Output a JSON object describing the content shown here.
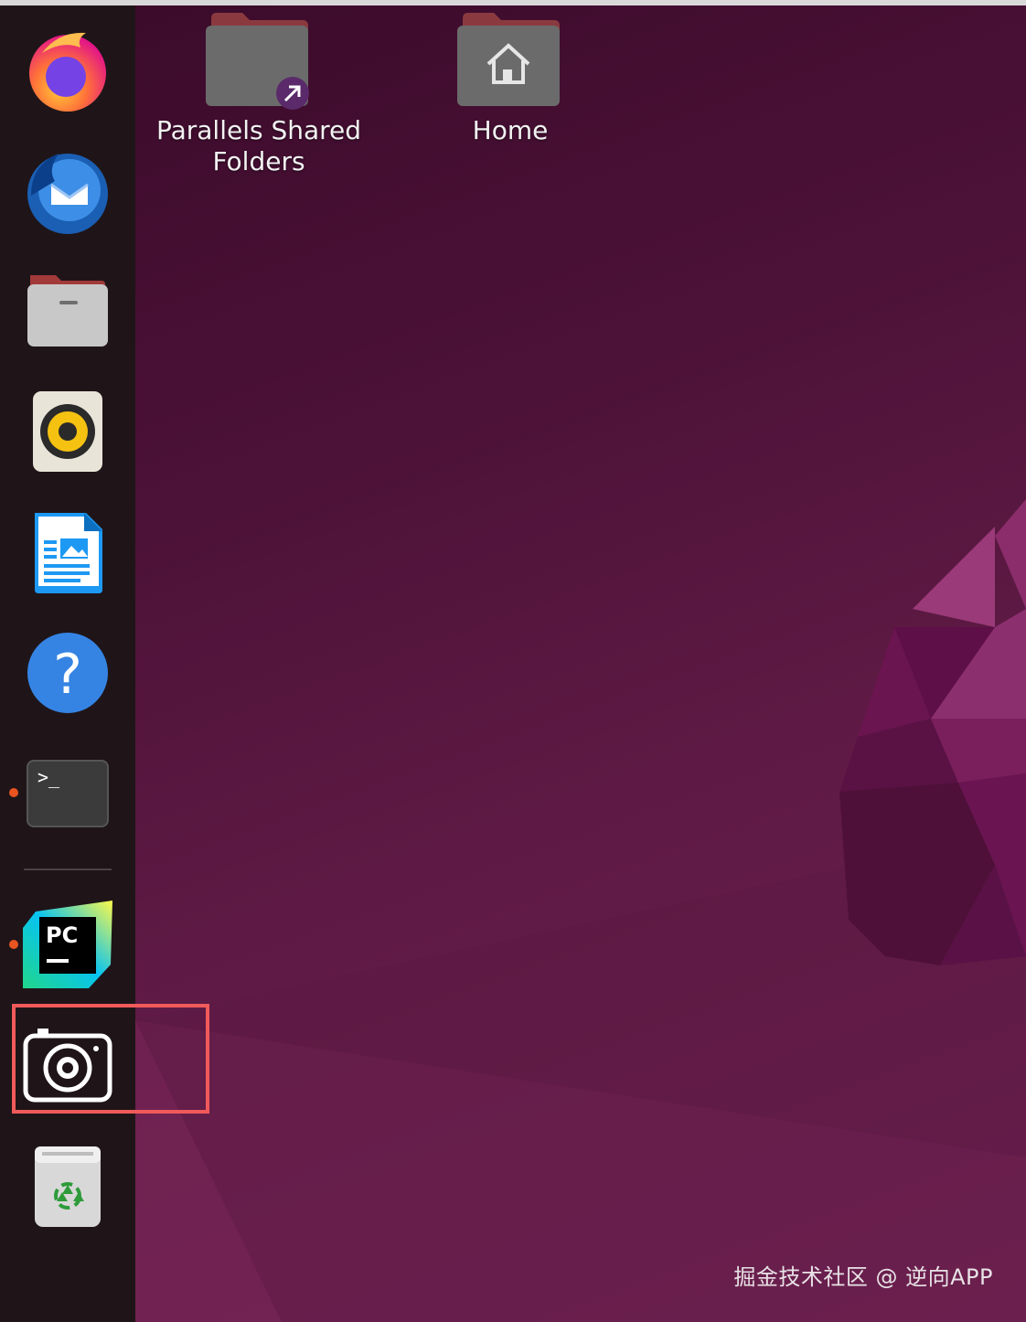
{
  "desktop": {
    "icons": [
      {
        "label": "Parallels Shared Folders",
        "icon": "shared-folder-icon"
      },
      {
        "label": "Home",
        "icon": "home-folder-icon"
      }
    ]
  },
  "dock": {
    "items": [
      {
        "icon": "firefox-icon",
        "running": false
      },
      {
        "icon": "thunderbird-icon",
        "running": false
      },
      {
        "icon": "files-icon",
        "running": false
      },
      {
        "icon": "rhythmbox-icon",
        "running": false
      },
      {
        "icon": "libreoffice-writer-icon",
        "running": false
      },
      {
        "icon": "help-icon",
        "running": false
      },
      {
        "icon": "terminal-icon",
        "running": true
      },
      {
        "icon": "pycharm-icon",
        "running": true
      },
      {
        "icon": "camera-icon",
        "running": false,
        "highlighted": true
      },
      {
        "icon": "trash-icon",
        "running": false
      }
    ],
    "pycharm_text": "PC",
    "terminal_text": ">_"
  },
  "watermark": "掘金技术社区 @ 逆向APP",
  "colors": {
    "accent_dot": "#e95420",
    "highlight_border": "#f05a5a"
  }
}
